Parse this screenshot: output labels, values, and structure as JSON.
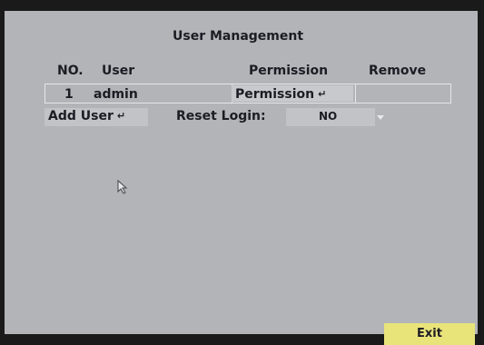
{
  "title": "User Management",
  "table": {
    "headers": {
      "no": "NO.",
      "user": "User",
      "permission": "Permission",
      "remove": "Remove"
    },
    "rows": [
      {
        "no": "1",
        "user": "admin",
        "permission_button": "Permission"
      }
    ]
  },
  "add_user_button": "Add User",
  "reset_login": {
    "label": "Reset Login:",
    "value": "NO"
  },
  "enter_glyph": "↵",
  "exit_button": "Exit",
  "colors": {
    "background": "#b3b4b8",
    "text": "#1c1c24",
    "exit_button": "#e9e47a",
    "border": "#e6e6ea"
  }
}
